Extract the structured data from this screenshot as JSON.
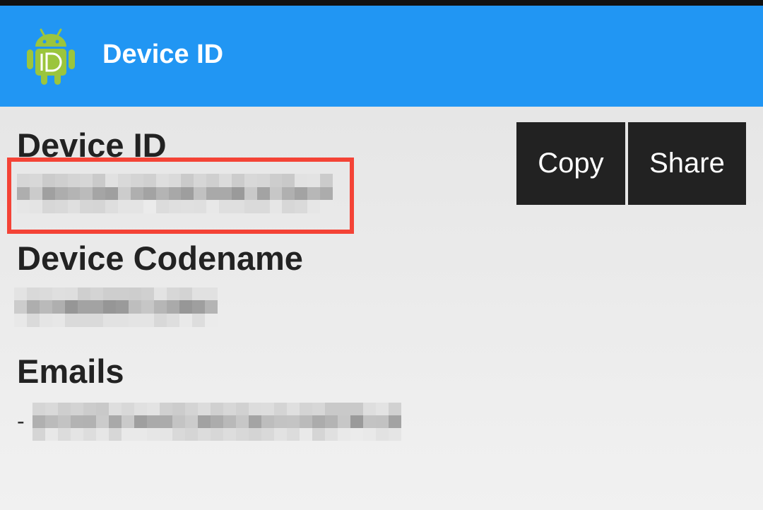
{
  "app": {
    "title": "Device ID",
    "icon": "android-id-icon",
    "bar_color": "#2196f3"
  },
  "sections": {
    "device_id": {
      "label": "Device ID"
    },
    "device_codename": {
      "label": "Device Codename"
    },
    "emails": {
      "label": "Emails",
      "bullet": "-"
    }
  },
  "actions": {
    "copy_label": "Copy",
    "share_label": "Share"
  },
  "colors": {
    "highlight": "#f44336",
    "button_bg": "#222222"
  }
}
